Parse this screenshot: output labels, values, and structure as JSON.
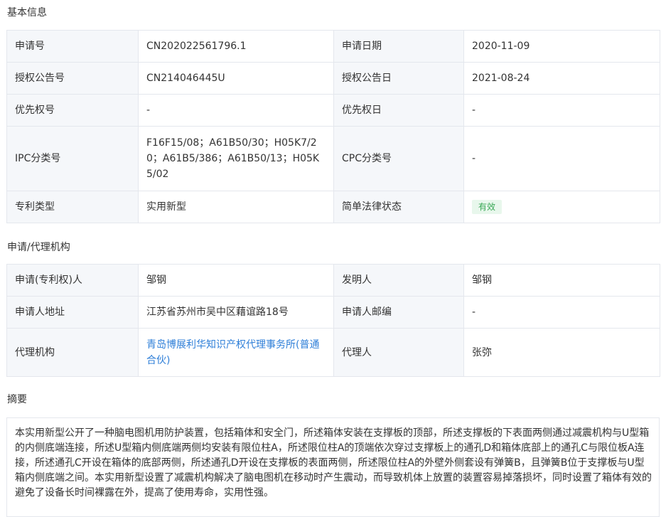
{
  "basic": {
    "title": "基本信息",
    "rows": [
      {
        "l1": "申请号",
        "v1": "CN202022561796.1",
        "l2": "申请日期",
        "v2": "2020-11-09"
      },
      {
        "l1": "授权公告号",
        "v1": "CN214046445U",
        "l2": "授权公告日",
        "v2": "2021-08-24"
      },
      {
        "l1": "优先权号",
        "v1": "-",
        "l2": "优先权日",
        "v2": "-"
      },
      {
        "l1": "IPC分类号",
        "v1": "F16F15/08；A61B50/30；H05K7/20；A61B5/386；A61B50/13；H05K5/02",
        "l2": "CPC分类号",
        "v2": "-"
      },
      {
        "l1": "专利类型",
        "v1": "实用新型",
        "l2": "简单法律状态",
        "v2": "有效"
      }
    ],
    "status_color": "#3aa856"
  },
  "agency": {
    "title": "申请/代理机构",
    "rows": [
      {
        "l1": "申请(专利权)人",
        "v1": "邹钢",
        "l2": "发明人",
        "v2": "邹钢"
      },
      {
        "l1": "申请人地址",
        "v1": "江苏省苏州市吴中区藉谊路18号",
        "l2": "申请人邮编",
        "v2": "-"
      },
      {
        "l1": "代理机构",
        "v1": "青岛博展利华知识产权代理事务所(普通合伙)",
        "l2": "代理人",
        "v2": "张弥"
      }
    ],
    "link_color": "#2f7fd8"
  },
  "abstract": {
    "title": "摘要",
    "text": "本实用新型公开了一种脑电图机用防护装置，包括箱体和安全门，所述箱体安装在支撑板的顶部，所述支撑板的下表面两侧通过减震机构与U型箱的内侧底端连接，所述U型箱内侧底端两侧均安装有限位柱A，所述限位柱A的顶端依次穿过支撑板上的通孔D和箱体底部上的通孔C与限位板A连接，所述通孔C开设在箱体的底部两侧，所述通孔D开设在支撑板的表面两侧，所述限位柱A的外壁外侧套设有弹簧B，且弹簧B位于支撑板与U型箱内侧底端之间。本实用新型设置了减震机构解决了脑电图机在移动时产生震动，而导致机体上放置的装置容易掉落损坏，同时设置了箱体有效的避免了设备长时间裸露在外，提高了使用寿命，实用性强。"
  }
}
